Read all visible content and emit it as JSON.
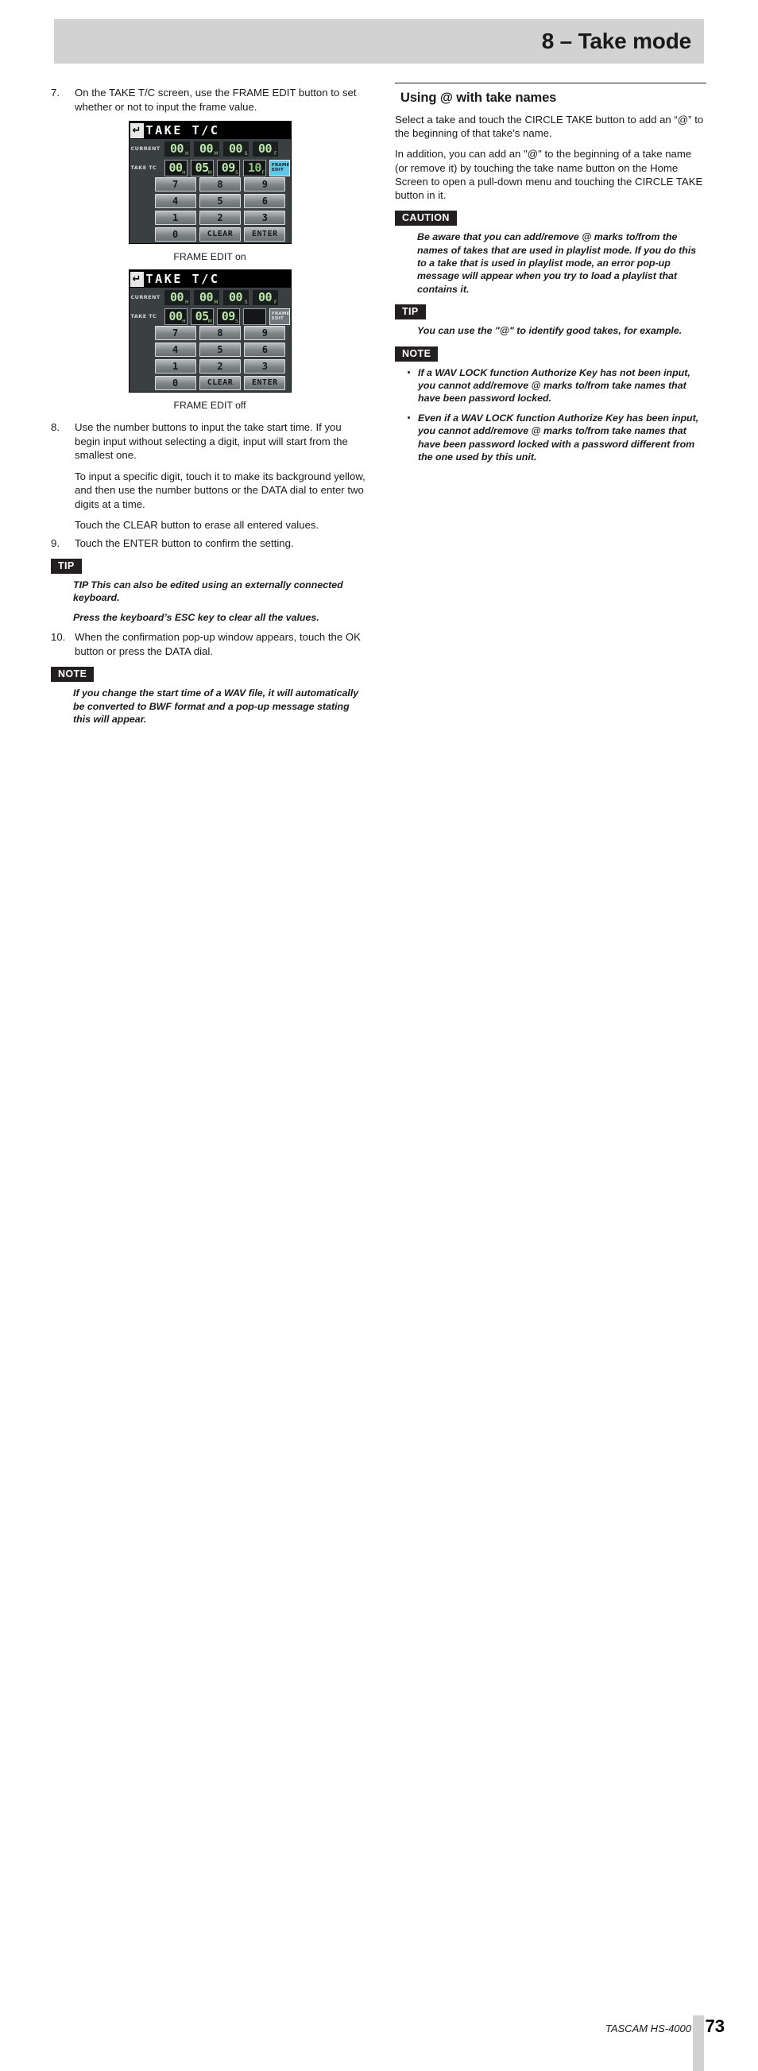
{
  "header": {
    "chapter_title": "8 – Take mode"
  },
  "left_column": {
    "step7": {
      "number": "7.",
      "text": "On the TAKE T/C screen, use the FRAME EDIT button to set whether or not to input the frame value."
    },
    "figure_on": {
      "caption": "FRAME EDIT on",
      "screen": {
        "back_icon": "return-arrow-icon",
        "title": "TAKE T/C",
        "current_label": "CURRENT",
        "take_label": "TAKE TC",
        "current_values": [
          {
            "digits": "00",
            "unit": "H"
          },
          {
            "digits": "00",
            "unit": "M"
          },
          {
            "digits": "00",
            "unit": "S"
          },
          {
            "digits": "00",
            "unit": "F"
          }
        ],
        "take_values": [
          {
            "digits": "00",
            "unit": "H"
          },
          {
            "digits": "05",
            "unit": "M"
          },
          {
            "digits": "09",
            "unit": "S"
          },
          {
            "digits": "10",
            "unit": "F"
          }
        ],
        "frame_edit_label_line1": "FRAME",
        "frame_edit_label_line2": "EDIT",
        "frame_edit_state": "on",
        "keypad": [
          [
            "7",
            "8",
            "9"
          ],
          [
            "4",
            "5",
            "6"
          ],
          [
            "1",
            "2",
            "3"
          ],
          [
            "0",
            "CLEAR",
            "ENTER"
          ]
        ]
      }
    },
    "figure_off": {
      "caption": "FRAME EDIT off",
      "screen": {
        "back_icon": "return-arrow-icon",
        "title": "TAKE T/C",
        "current_label": "CURRENT",
        "take_label": "TAKE TC",
        "current_values": [
          {
            "digits": "00",
            "unit": "H"
          },
          {
            "digits": "00",
            "unit": "M"
          },
          {
            "digits": "00",
            "unit": "S"
          },
          {
            "digits": "00",
            "unit": "F"
          }
        ],
        "take_values": [
          {
            "digits": "00",
            "unit": "H"
          },
          {
            "digits": "05",
            "unit": "M"
          },
          {
            "digits": "09",
            "unit": "S"
          },
          {
            "digits": "",
            "unit": ""
          }
        ],
        "frame_edit_label_line1": "FRAME",
        "frame_edit_label_line2": "EDIT",
        "frame_edit_state": "off",
        "keypad": [
          [
            "7",
            "8",
            "9"
          ],
          [
            "4",
            "5",
            "6"
          ],
          [
            "1",
            "2",
            "3"
          ],
          [
            "0",
            "CLEAR",
            "ENTER"
          ]
        ]
      }
    },
    "step8": {
      "number": "8.",
      "para1": "Use the number buttons to input the take start time. If you begin input without selecting a digit, input will start from the smallest one.",
      "para2": "To input a specific digit, touch it to make its background yellow, and then use the number buttons or the DATA dial to enter two digits at a time.",
      "para3": "Touch the CLEAR button to erase all entered values."
    },
    "step9": {
      "number": "9.",
      "text": "Touch the ENTER button to confirm the setting."
    },
    "tip": {
      "tag": "TIP",
      "para1": "TIP This can also be edited using an externally connected keyboard.",
      "para2": "Press the keyboard’s ESC key to clear all the values."
    },
    "step10": {
      "number": "10.",
      "text": "When the confirmation pop-up window appears, touch the OK button or press the DATA dial."
    },
    "note": {
      "tag": "NOTE",
      "para1": "If you change the start time of a WAV file, it will automatically be converted to BWF format and a pop-up message stating this will appear."
    }
  },
  "right_column": {
    "heading": "Using @ with take names",
    "para1": "Select a take and touch the CIRCLE TAKE button to add an “@” to the beginning of that take’s name.",
    "para2": "In addition, you can add an \"@\" to the beginning of a take name (or remove it) by touching the take name button on the Home Screen to open a pull-down menu and touching the CIRCLE TAKE button in it.",
    "caution": {
      "tag": "CAUTION",
      "para1": "Be aware that you can add/remove @ marks to/from the names of takes that are used in playlist mode. If you do this to a take that is used in playlist mode, an error pop-up message will appear when you try to load a playlist that contains it."
    },
    "tip": {
      "tag": "TIP",
      "para1": "You can use the \"@\" to identify good takes, for example."
    },
    "note": {
      "tag": "NOTE",
      "bullets": [
        "If a WAV LOCK function Authorize Key has not been input, you cannot add/remove @ marks to/from take names that have been password locked.",
        "Even if a WAV LOCK function Authorize Key has been input, you cannot add/remove @ marks to/from take names that have been password locked with a password different from the one used by this unit."
      ]
    }
  },
  "footer": {
    "product": "TASCAM HS-4000",
    "page_number": "73"
  }
}
